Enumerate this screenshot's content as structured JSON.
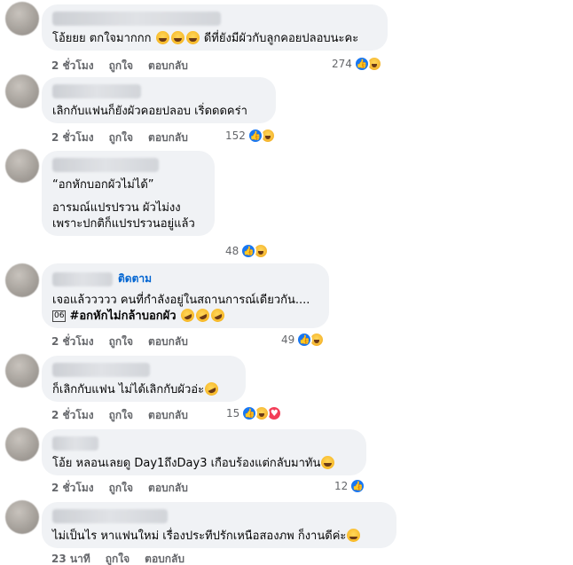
{
  "actions": {
    "like": "ถูกใจ",
    "reply": "ตอบกลับ"
  },
  "comments": [
    {
      "time": "2 ชั่วโมง",
      "reactions": "274",
      "text": "โอ้ยยย ตกใจมากกก",
      "text2": "ดีที่ยังมีผัวกับลูกคอยปลอบนะคะ"
    },
    {
      "time": "2 ชั่วโมง",
      "reactions": "152",
      "text": "เลิกกับแฟนก็ยังผัวคอยปลอบ เริ่ดดดคร่า"
    },
    {
      "time": "2 ชั่วโมง",
      "reactions": "48",
      "p1": "“อกหักบอกผัวไม่ได้”",
      "p2": "อารมณ์แปรปรวน ผัวไม่งง",
      "p3": "เพราะปกติก็แปรปรวนอยู่แล้ว"
    },
    {
      "time": "2 ชั่วโมง",
      "reactions": "49",
      "follow": "ติดตาม",
      "line1": "เจอแล้ววววว คนที่กำลังอยู่ในสถานการณ์เดียวกัน....",
      "icon_text": "06",
      "hashtag": "#อกหักไม่กล้าบอกผัว"
    },
    {
      "time": "2 ชั่วโมง",
      "reactions": "15",
      "text": "ก็เลิกกับแฟน ไม่ได้เลิกกับผัวอ่ะ"
    },
    {
      "time": "2 ชั่วโมง",
      "reactions": "12",
      "text": "โอ้ย หลอนเลยดู Day1ถึงDay3 เกือบร้องแต่กลับมาทัน"
    },
    {
      "time": "23 นาที",
      "text": "ไม่เป็นไร หาแฟนใหม่ เรื่องประทีปรักเหนือสองภพ ก็งานดีค่ะ"
    }
  ]
}
